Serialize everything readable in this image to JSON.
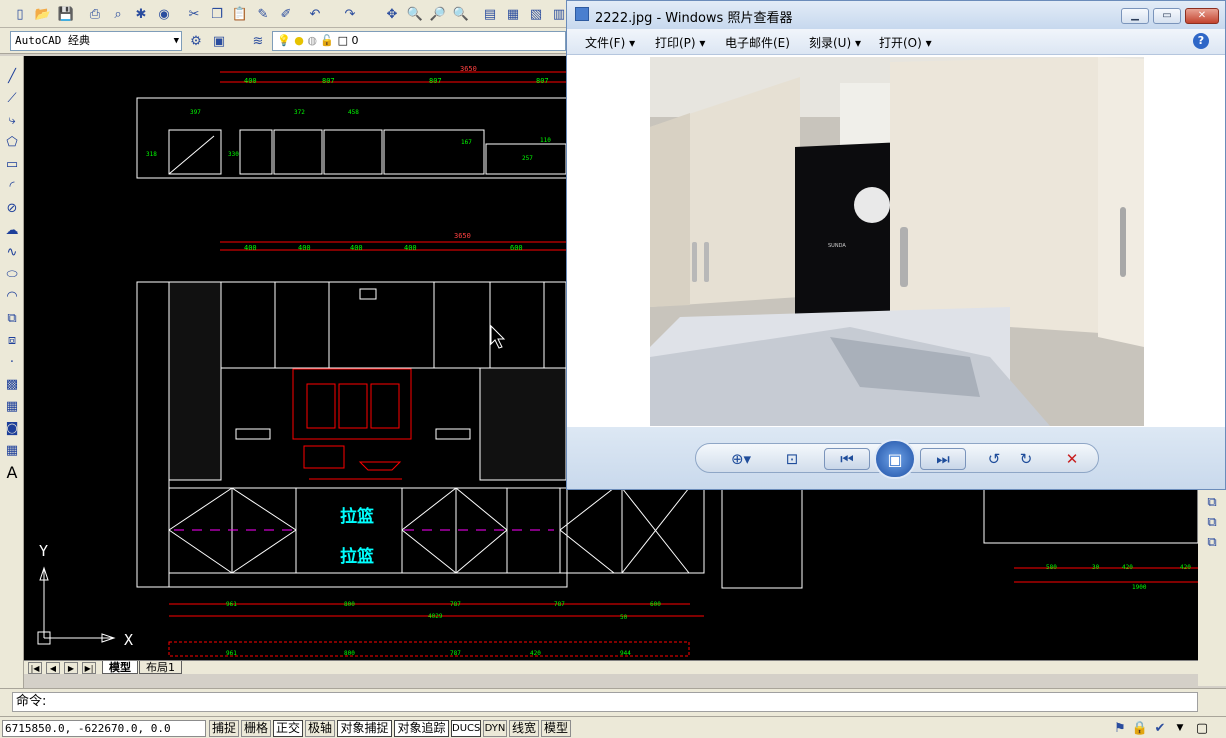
{
  "autocad": {
    "workspace": "AutoCAD 经典",
    "layer": "0",
    "cmd_prompt": "命令:",
    "coords": "6715850.0, -622670.0, 0.0",
    "status_buttons": [
      "捕捉",
      "栅格",
      "正交",
      "极轴",
      "对象捕捉",
      "对象追踪",
      "DUCS",
      "DYN",
      "线宽",
      "模型"
    ],
    "tabs": [
      "模型",
      "布局1"
    ],
    "drawing_labels": {
      "top_overall": "3650",
      "top_dims": [
        "400",
        "807",
        "807",
        "807"
      ],
      "mid_overall": "3650",
      "mid_dims": [
        "400",
        "400",
        "400",
        "400",
        "600"
      ],
      "upper_small": [
        "397",
        "372",
        "458",
        "257",
        "318",
        "330",
        "167",
        "110"
      ],
      "basket1": "拉篮",
      "basket2": "拉篮",
      "bottom_dims": [
        "961",
        "800",
        "787",
        "787",
        "600"
      ],
      "bottom_overall": "4029",
      "bottom_small": "50",
      "red_dims": [
        "961",
        "800",
        "787",
        "420",
        "944"
      ],
      "right_dims": [
        "580",
        "30",
        "420",
        "420"
      ],
      "right_overall": "1900",
      "axis_x": "X",
      "axis_y": "Y"
    }
  },
  "viewer": {
    "title": "2222.jpg - Windows 照片查看器",
    "menu": [
      "文件(F)",
      "打印(P)",
      "电子邮件(E)",
      "刻录(U)",
      "打开(O)"
    ],
    "photo_brand": "SUNDA"
  }
}
